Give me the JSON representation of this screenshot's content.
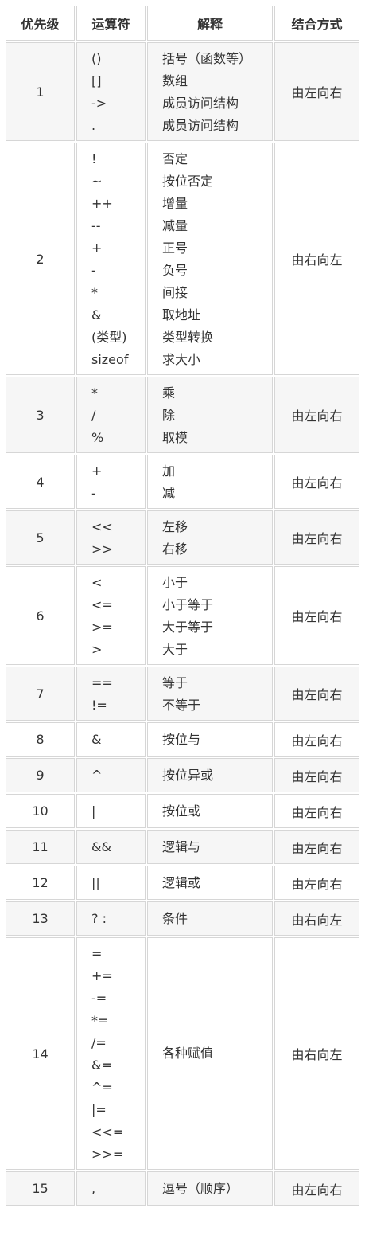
{
  "table": {
    "headers": [
      "优先级",
      "运算符",
      "解释",
      "结合方式"
    ],
    "rows": [
      {
        "level": "1",
        "ops": [
          "()",
          "[]",
          "->",
          "."
        ],
        "desc": [
          "括号（函数等）",
          "数组",
          "成员访问结构",
          "成员访问结构"
        ],
        "assoc": "由左向右"
      },
      {
        "level": "2",
        "ops": [
          "!",
          "~",
          "++",
          "--",
          "+",
          "-",
          "*",
          "&",
          "(类型)",
          "sizeof"
        ],
        "desc": [
          "否定",
          "按位否定",
          "增量",
          "减量",
          "正号",
          "负号",
          "间接",
          "取地址",
          "类型转换",
          "求大小"
        ],
        "assoc": "由右向左"
      },
      {
        "level": "3",
        "ops": [
          "*",
          "/",
          "%"
        ],
        "desc": [
          "乘",
          "除",
          "取模"
        ],
        "assoc": "由左向右"
      },
      {
        "level": "4",
        "ops": [
          "+",
          "-"
        ],
        "desc": [
          "加",
          "减"
        ],
        "assoc": "由左向右"
      },
      {
        "level": "5",
        "ops": [
          "<<",
          ">>"
        ],
        "desc": [
          "左移",
          "右移"
        ],
        "assoc": "由左向右"
      },
      {
        "level": "6",
        "ops": [
          "<",
          "<=",
          ">=",
          ">"
        ],
        "desc": [
          "小于",
          "小于等于",
          "大于等于",
          "大于"
        ],
        "assoc": "由左向右"
      },
      {
        "level": "7",
        "ops": [
          "==",
          "!="
        ],
        "desc": [
          "等于",
          "不等于"
        ],
        "assoc": "由左向右"
      },
      {
        "level": "8",
        "ops": [
          "&"
        ],
        "desc": [
          "按位与"
        ],
        "assoc": "由左向右"
      },
      {
        "level": "9",
        "ops": [
          "^"
        ],
        "desc": [
          "按位异或"
        ],
        "assoc": "由左向右"
      },
      {
        "level": "10",
        "ops": [
          "|"
        ],
        "desc": [
          "按位或"
        ],
        "assoc": "由左向右"
      },
      {
        "level": "11",
        "ops": [
          "&&"
        ],
        "desc": [
          "逻辑与"
        ],
        "assoc": "由左向右"
      },
      {
        "level": "12",
        "ops": [
          "||"
        ],
        "desc": [
          "逻辑或"
        ],
        "assoc": "由左向右"
      },
      {
        "level": "13",
        "ops": [
          "? :"
        ],
        "desc": [
          "条件"
        ],
        "assoc": "由右向左"
      },
      {
        "level": "14",
        "ops": [
          "=",
          "+=",
          "-=",
          "*=",
          "/=",
          "&=",
          "^=",
          "|=",
          "<<=",
          ">>="
        ],
        "desc": [
          "各种赋值"
        ],
        "assoc": "由右向左"
      },
      {
        "level": "15",
        "ops": [
          ","
        ],
        "desc": [
          "逗号（顺序）"
        ],
        "assoc": "由左向右"
      }
    ]
  }
}
